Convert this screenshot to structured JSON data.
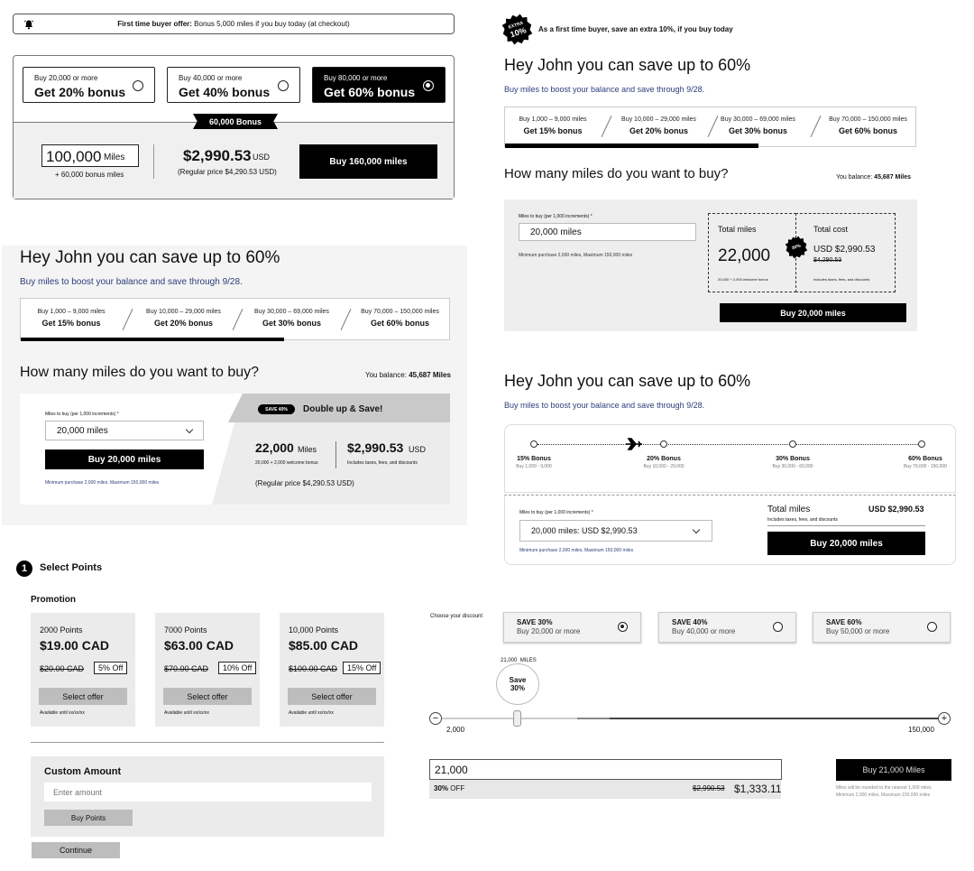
{
  "panelA": {
    "banner_prefix": "First time buyer offer:",
    "banner_text": " Bonus 5,000 miles if you buy today (at checkout)",
    "options": [
      {
        "small": "Buy 20,000 or more",
        "big": "Get 20% bonus",
        "selected": false
      },
      {
        "small": "Buy 40,000 or more",
        "big": "Get 40% bonus",
        "selected": false
      },
      {
        "small": "Buy 80,000 or more",
        "big": "Get 60% bonus",
        "selected": true
      }
    ],
    "ribbon": "60,000 Bonus",
    "miles_value": "100,000",
    "miles_unit": "Miles",
    "bonus_text": "+ 60,000 bonus miles",
    "price": "$2,990.53",
    "price_unit": "USD",
    "regular": "(Regular price $4,290.53 USD)",
    "buy_label": "Buy 160,000 miles"
  },
  "panelB": {
    "title": "Hey John you can save up to 60%",
    "subtitle": "Buy miles to boost your balance and save through 9/28.",
    "tiers": [
      {
        "range": "Buy 1,000 – 9,000 miles",
        "bonus": "Get 15% bonus"
      },
      {
        "range": "Buy 10,000 – 29,000 miles",
        "bonus": "Get 20% bonus"
      },
      {
        "range": "Buy 30,000 – 69,000 miles",
        "bonus": "Get 30% bonus"
      },
      {
        "range": "Buy 70,000 – 150,000 miles",
        "bonus": "Get 60% bonus"
      }
    ],
    "question": "How many miles do you want to buy?",
    "balance_label": "You balance: ",
    "balance_value": "45,687 Miles",
    "field_label": "Miles to buy (per 1,000 increments) *",
    "select_value": "20,000 miles",
    "buy_label": "Buy 20,000 miles",
    "min_text": "Minimum purchase 2,000 miles, Maximum 150,000 miles",
    "save_pill": "SAVE 40%",
    "double_text": "Double up & Save!",
    "miles_value": "22,000",
    "miles_unit": "Miles",
    "welcome": "20,000 + 2,000 welcome bonus",
    "price": "$2,990.53",
    "price_unit": "USD",
    "includes": "Includes taxes, fees, and discounts",
    "regular": "(Regular price $4,290.53 USD)"
  },
  "panelC": {
    "badge_top": "EXTRA",
    "badge_big": "10%",
    "offer": "As a first time buyer, save an extra 10%, if you buy today",
    "title": "Hey John you can save up to 60%",
    "subtitle": "Buy miles to boost your balance and save through 9/28.",
    "tiers": [
      {
        "range": "Buy 1,000 – 9,000 miles",
        "bonus": "Get 15% bonus"
      },
      {
        "range": "Buy 10,000 – 29,000 miles",
        "bonus": "Get 20% bonus"
      },
      {
        "range": "Buy 30,000 – 69,000 miles",
        "bonus": "Get 30% bonus"
      },
      {
        "range": "Buy 70,000 – 150,000 miles",
        "bonus": "Get 60% bonus"
      }
    ],
    "question": "How many miles do you want to buy?",
    "balance_label": "You balance: ",
    "balance_value": "45,687 Miles",
    "field_label": "Miles to buy (per 1,000 increments) *",
    "input_value": "20,000 miles",
    "min_text": "Minimum purchase 2,000 miles, Maximum 150,000 miles",
    "total_miles_label": "Total miles",
    "total_miles_value": "22,000",
    "welcome": "20,000 + 2,000 welcome bonus",
    "badge2": "30%",
    "total_cost_label": "Total cost",
    "cost_value": "USD $2,990.53",
    "cost_old": "$4,290.53",
    "includes": "Includes taxes, fees, and discounts",
    "buy_label": "Buy 20,000 miles"
  },
  "panelD": {
    "title": "Hey John you can save up to 60%",
    "subtitle": "Buy miles to boost your balance and save through 9/28.",
    "stops": [
      {
        "bonus": "15% Bonus",
        "range": "Buy 1,000 - 9,000"
      },
      {
        "bonus": "20% Bonus",
        "range": "Buy 10,000 - 29,000"
      },
      {
        "bonus": "30% Bonus",
        "range": "Buy 30,000 - 69,000"
      },
      {
        "bonus": "60% Bonus",
        "range": "Buy 70,000 - 150,000"
      }
    ],
    "field_label": "Miles to buy (per 1,000 increments) *",
    "select_value": "20,000 miles: USD $2,990.53",
    "min_text": "Minimum purchase 2,000 miles, Maximum 150,000 miles",
    "total_label": "Total miles",
    "total_value": "USD $2,990.53",
    "includes": "Includes taxes, fees, and discounts",
    "buy_label": "Buy 20,000 miles"
  },
  "panelF": {
    "step_number": "1",
    "step_title": "Select Points",
    "promotion_label": "Promotion",
    "cards": [
      {
        "points": "2000 Points",
        "price": "$19.00 CAD",
        "old": "$20.00 CAD",
        "off": "5% Off",
        "select": "Select offer",
        "avail": "Available until xx/xx/xx"
      },
      {
        "points": "7000 Points",
        "price": "$63.00 CAD",
        "old": "$70.00 CAD",
        "off": "10% Off",
        "select": "Select offer",
        "avail": "Available until xx/xx/xx"
      },
      {
        "points": "10,000 Points",
        "price": "$85.00 CAD",
        "old": "$100.00 CAD",
        "off": "15% Off",
        "select": "Select offer",
        "avail": "Available until xx/xx/xx"
      }
    ],
    "custom_title": "Custom Amount",
    "amount_placeholder": "Enter amount",
    "buy_points": "Buy Points",
    "continue": "Continue"
  },
  "panelG": {
    "choose_label": "Choose your discount",
    "options": [
      {
        "title": "SAVE 30%",
        "sub": "Buy 20,000 or more",
        "selected": true
      },
      {
        "title": "SAVE 40%",
        "sub": "Buy 40,000 or more",
        "selected": false
      },
      {
        "title": "SAVE 60%",
        "sub": "Buy 50,000 or more",
        "selected": false
      }
    ],
    "slider_value": "21,000",
    "slider_unit": "MILES",
    "bubble_line1": "Save",
    "bubble_line2": "30%",
    "min_label": "2,000",
    "max_label": "150,000",
    "input_value": "21,000",
    "off_strong": "30%",
    "off_text": " OFF",
    "old_price": "$2,990.53",
    "new_price": "$1,333.11",
    "buy_label": "Buy 21,000 Miles",
    "note1": "Miles will be rounded to the nearest 1,000 miles",
    "note2": "Minimum 2,000 miles, Maximum 150,000 miles"
  }
}
